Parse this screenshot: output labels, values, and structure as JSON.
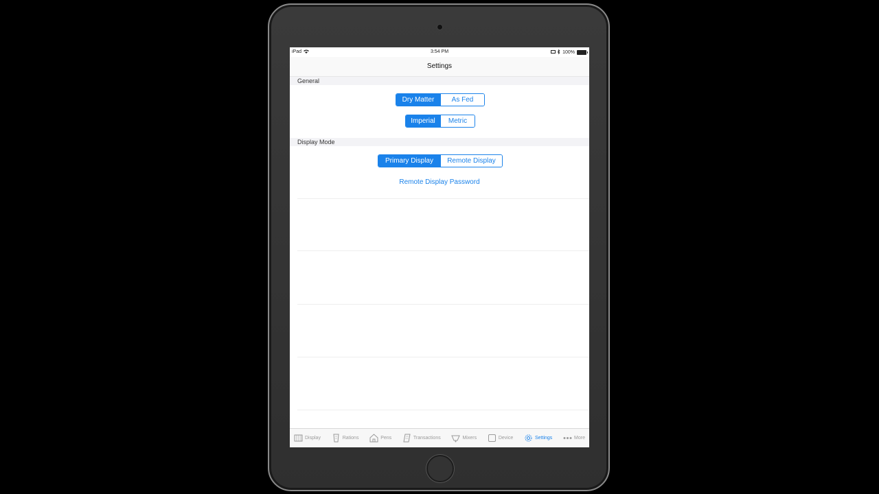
{
  "status_bar": {
    "device": "iPad",
    "time": "3:54 PM",
    "battery": "100%"
  },
  "nav": {
    "title": "Settings"
  },
  "sections": {
    "general": "General",
    "display_mode": "Display Mode"
  },
  "controls": {
    "basis": {
      "options": [
        "Dry Matter",
        "As Fed"
      ],
      "selected": "Dry Matter"
    },
    "units": {
      "options": [
        "Imperial",
        "Metric"
      ],
      "selected": "Imperial"
    },
    "display": {
      "options": [
        "Primary Display",
        "Remote Display"
      ],
      "selected": "Primary Display"
    },
    "password_link": "Remote Display Password"
  },
  "tabs": [
    {
      "label": "Display",
      "icon": "display-icon"
    },
    {
      "label": "Rations",
      "icon": "rations-icon"
    },
    {
      "label": "Pens",
      "icon": "pens-icon"
    },
    {
      "label": "Transactions",
      "icon": "transactions-icon"
    },
    {
      "label": "Mixers",
      "icon": "mixers-icon"
    },
    {
      "label": "Device",
      "icon": "device-icon"
    },
    {
      "label": "Settings",
      "icon": "gear-icon",
      "active": true
    },
    {
      "label": "More",
      "icon": "more-icon"
    }
  ],
  "colors": {
    "accent": "#1a82ea",
    "bezel": "#333333"
  }
}
